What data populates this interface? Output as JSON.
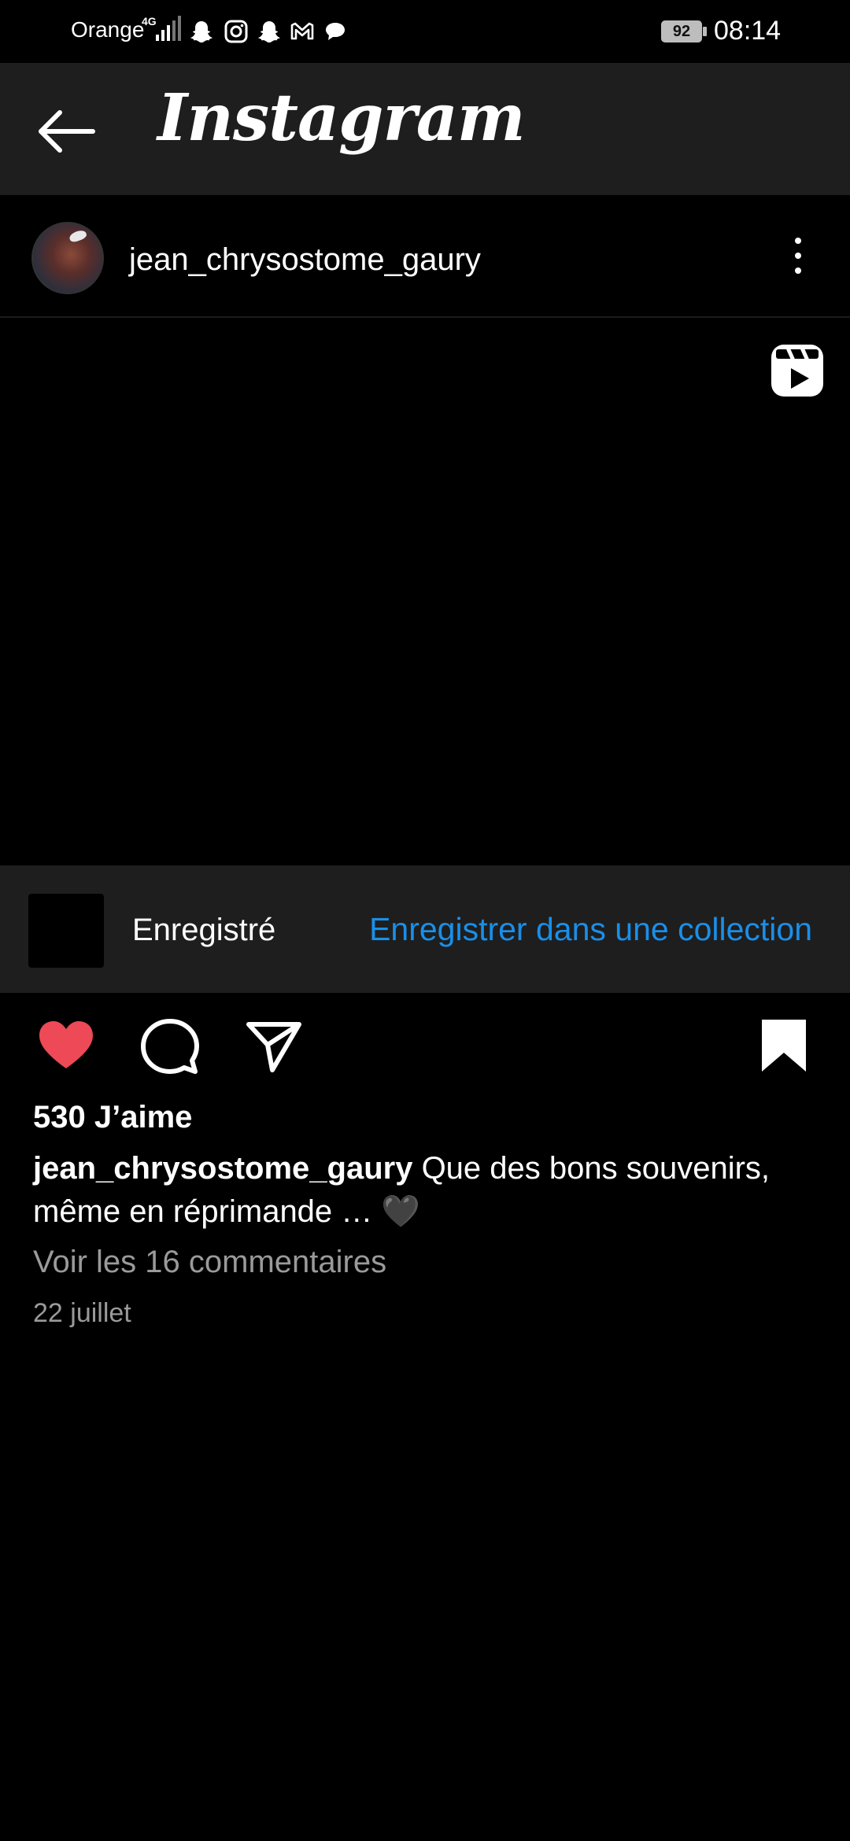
{
  "status_bar": {
    "carrier": "Orange",
    "network": "4G",
    "battery": "92",
    "time": "08:14",
    "icons": [
      "signal-icon",
      "snapchat-icon",
      "instagram-icon",
      "snapchat-icon",
      "gmail-icon",
      "messaging-icon"
    ]
  },
  "app_bar": {
    "title": "Instagram",
    "back_icon": "arrow-left-icon"
  },
  "post": {
    "username": "jean_chrysostome_gaury",
    "media_icon": "reels-icon",
    "saved_label": "Enregistré",
    "save_collection_label": "Enregistrer dans une collection",
    "likes": "530 J’aime",
    "caption_user": "jean_chrysostome_gaury",
    "caption_text": " Que des bons souvenirs, même en réprimande … 🖤",
    "comments_link": "Voir les 16 commentaires",
    "date": "22 juillet"
  },
  "colors": {
    "background": "#000000",
    "bar": "#1e1e1e",
    "like": "#ed4956",
    "link": "#1a8fe8",
    "secondary_text": "#9a9a9a"
  }
}
